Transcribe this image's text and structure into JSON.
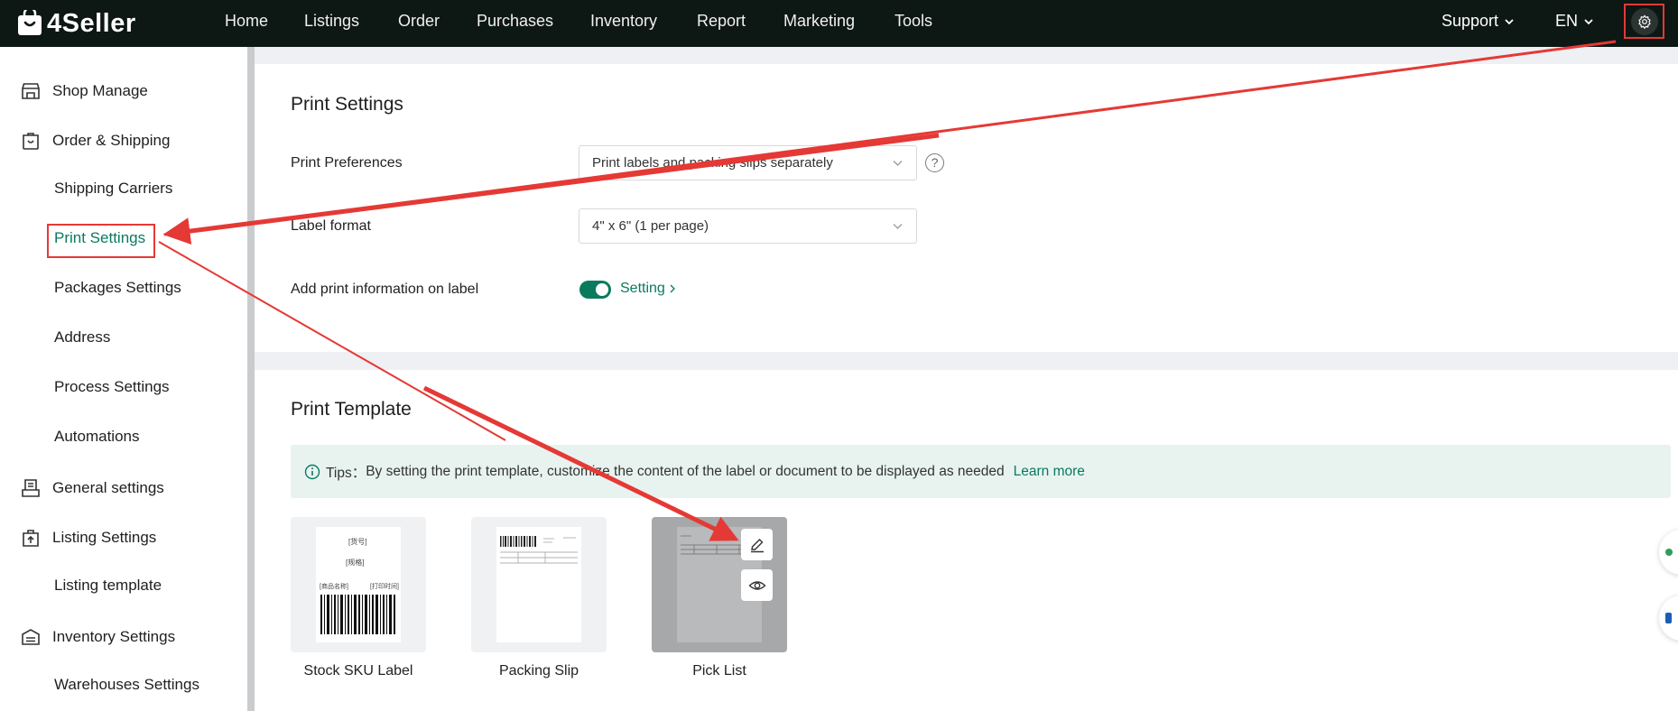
{
  "app": {
    "brand": "4Seller",
    "accent": "#0a7a5e",
    "annotation_color": "#e53935"
  },
  "nav": [
    "Home",
    "Listings",
    "Order",
    "Purchases",
    "Inventory",
    "Report",
    "Marketing",
    "Tools"
  ],
  "topright": {
    "support": "Support",
    "lang": "EN",
    "settings_icon": "gear-icon"
  },
  "sidebar": {
    "items": [
      {
        "label": "Shop Manage",
        "icon": "store-icon"
      },
      {
        "label": "Order & Shipping",
        "icon": "bag-icon"
      },
      {
        "label": "Shipping Carriers"
      },
      {
        "label": "Print Settings",
        "active": true
      },
      {
        "label": "Packages Settings"
      },
      {
        "label": "Address"
      },
      {
        "label": "Process Settings"
      },
      {
        "label": "Automations"
      },
      {
        "label": "General settings",
        "icon": "printer-icon"
      },
      {
        "label": "Listing Settings",
        "icon": "upload-bag-icon"
      },
      {
        "label": "Listing template"
      },
      {
        "label": "Inventory Settings",
        "icon": "warehouse-icon"
      },
      {
        "label": "Warehouses Settings"
      }
    ]
  },
  "print_settings": {
    "title": "Print Settings",
    "preferences_label": "Print Preferences",
    "preferences_value": "Print labels and packing slips separately",
    "label_format_label": "Label format",
    "label_format_value": "4\" x 6\" (1 per page)",
    "add_info_label": "Add print information on label",
    "add_info_enabled": true,
    "setting_link": "Setting"
  },
  "print_template": {
    "title": "Print Template",
    "tips_prefix": "Tips：",
    "tips_text": "By setting the print template, customize the content of the label or document to be displayed as needed",
    "learn_more": "Learn more",
    "templates": [
      {
        "name": "Stock SKU Label",
        "sample": {
          "line1": "[货号]",
          "line2": "[商品名称]",
          "line3": "[规格]",
          "line4": "[打印时间]"
        }
      },
      {
        "name": "Packing Slip"
      },
      {
        "name": "Pick List",
        "hovered": true,
        "actions": [
          "edit-icon",
          "eye-icon"
        ]
      }
    ]
  }
}
